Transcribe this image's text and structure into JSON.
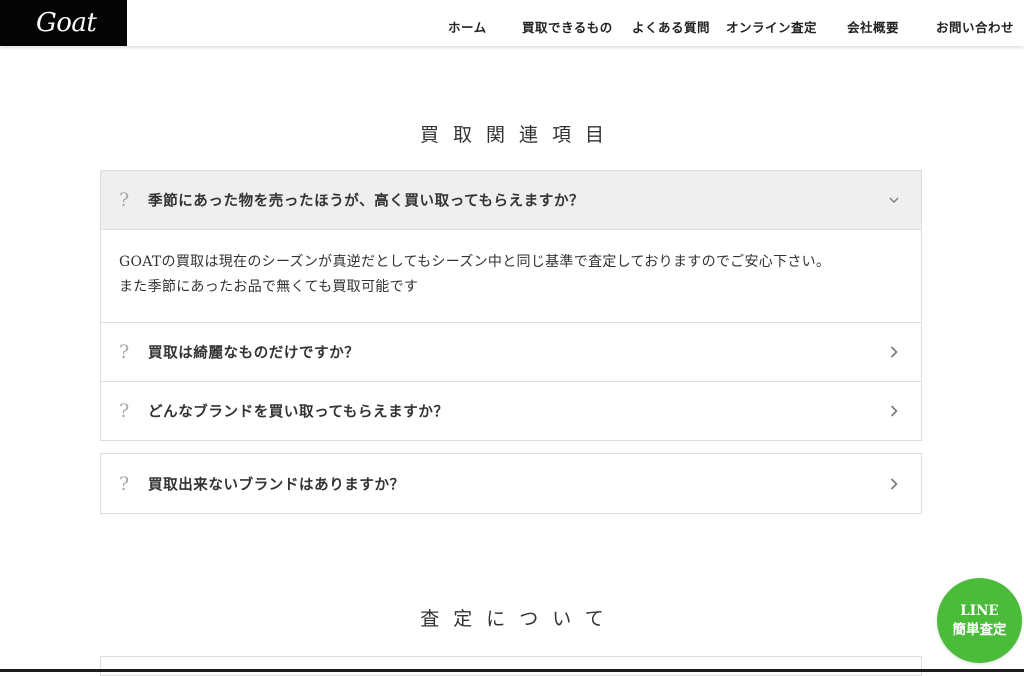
{
  "header": {
    "logo": "Goat",
    "nav": [
      {
        "label": "ホーム"
      },
      {
        "label": "買取できるもの"
      },
      {
        "label": "よくある質問"
      },
      {
        "label": "オンライン査定"
      },
      {
        "label": "会社概要"
      },
      {
        "label": "お問い合わせ"
      }
    ]
  },
  "related": {
    "title": "買取関連項目",
    "faq_open": {
      "question": "季節にあった物を売ったほうが、高く買い取ってもらえますか？",
      "answer_line1": "GOATの買取は現在のシーズンが真逆だとしてもシーズン中と同じ基準で査定しておりますのでご安心下さい。",
      "answer_line2": "また季節にあったお品で無くても買取可能です"
    },
    "faq_items": [
      {
        "question": "買取は綺麗なものだけですか？"
      },
      {
        "question": "どんなブランドを買い取ってもらえますか？"
      }
    ],
    "faq_single": {
      "question": "買取出来ないブランドはありますか？"
    },
    "qmark": "?"
  },
  "assessment": {
    "title": "査定について"
  },
  "line_button": {
    "line1": "LINE",
    "line2": "簡単査定",
    "color": "#4bbb3a"
  },
  "icons": {
    "chevron_down": "chevron-down-icon",
    "chevron_right": "chevron-right-icon"
  }
}
